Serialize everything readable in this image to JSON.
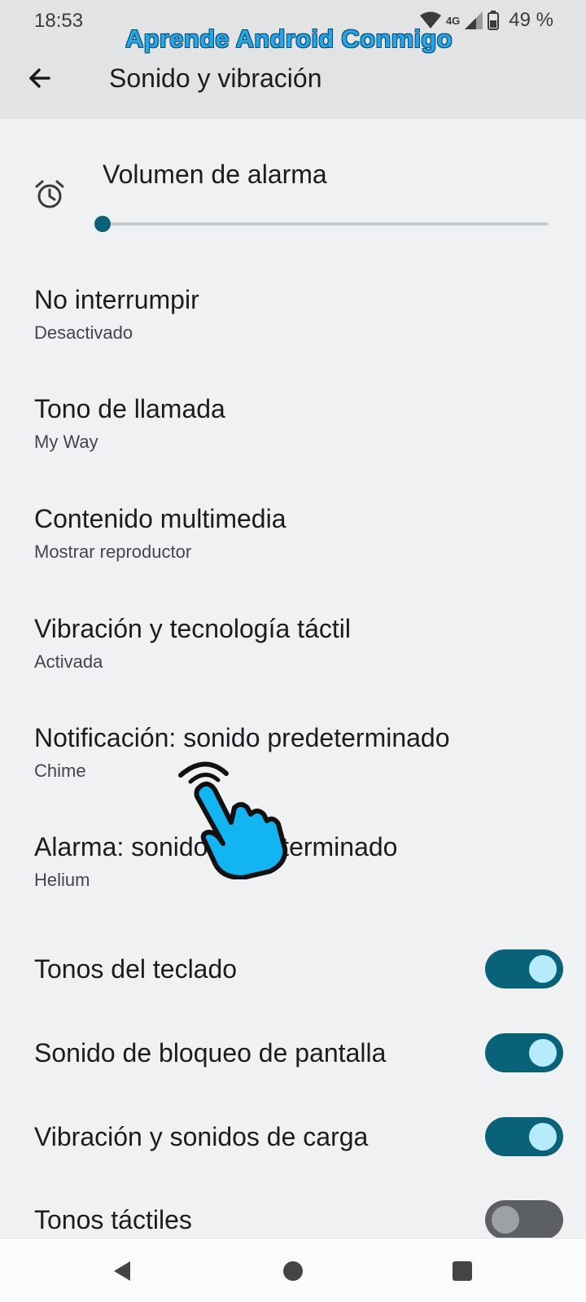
{
  "status": {
    "time": "18:53",
    "network": "4G",
    "battery": "49 %"
  },
  "watermark": "Aprende Android Conmigo",
  "header": {
    "title": "Sonido y vibración",
    "back_icon": "arrow-back-icon"
  },
  "alarm_volume": {
    "title": "Volumen de alarma",
    "icon": "alarm-clock-icon",
    "level": 0.0
  },
  "items": [
    {
      "title": "No interrumpir",
      "subtitle": "Desactivado"
    },
    {
      "title": "Tono de llamada",
      "subtitle": "My Way"
    },
    {
      "title": "Contenido multimedia",
      "subtitle": "Mostrar reproductor"
    },
    {
      "title": "Vibración y tecnología táctil",
      "subtitle": "Activada"
    },
    {
      "title": "Notificación: sonido predeterminado",
      "subtitle": "Chime"
    },
    {
      "title": "Alarma: sonido predeterminado",
      "subtitle": "Helium"
    }
  ],
  "toggles": [
    {
      "title": "Tonos del teclado",
      "on": true
    },
    {
      "title": "Sonido de bloqueo de pantalla",
      "on": true
    },
    {
      "title": "Vibración y sonidos de carga",
      "on": true
    },
    {
      "title": "Tonos táctiles",
      "on": false
    }
  ],
  "colors": {
    "accent": "#0a6278",
    "toggle_knob_on": "#b6ebfb",
    "background": "#eff1f3",
    "header": "#e2e3e5"
  }
}
